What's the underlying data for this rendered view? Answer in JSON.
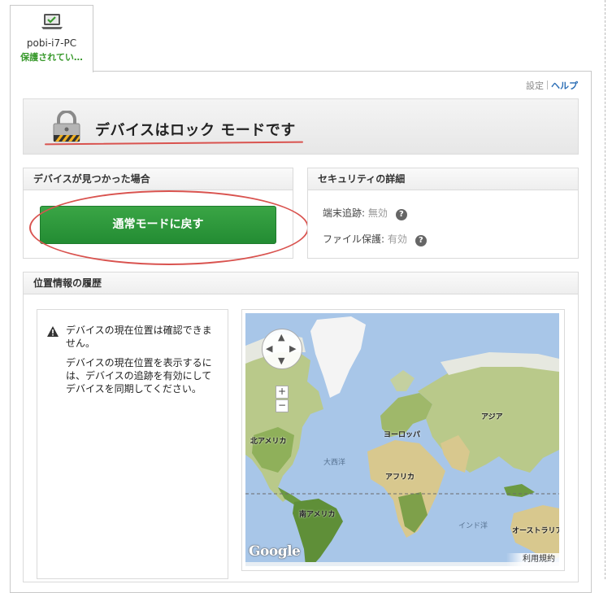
{
  "device_tab": {
    "name": "pobi-i7-PC",
    "status": "保護されてい…",
    "icon": "laptop-check-icon"
  },
  "links": {
    "settings": "設定",
    "help": "ヘルプ"
  },
  "banner": {
    "title": "デバイスはロック モードです",
    "icon": "padlock-icon"
  },
  "found_panel": {
    "title": "デバイスが見つかった場合",
    "button": "通常モードに戻す"
  },
  "security_panel": {
    "title": "セキュリティの詳細",
    "rows": [
      {
        "label": "端末追跡: ",
        "value": "無効"
      },
      {
        "label": "ファイル保護: ",
        "value": "有効"
      }
    ],
    "help_icon": "?"
  },
  "history_panel": {
    "title": "位置情報の履歴",
    "message_primary": "デバイスの現在位置は確認できません。",
    "message_secondary": "デバイスの現在位置を表示するには、デバイスの追跡を有効にしてデバイスを同期してください。"
  },
  "map": {
    "labels": {
      "north_america": "北アメリカ",
      "europe": "ヨーロッパ",
      "asia": "アジア",
      "atlantic": "大西洋",
      "africa": "アフリカ",
      "south_america": "南アメリカ",
      "indian_ocean": "インド洋",
      "australia": "オーストラリア"
    },
    "zoom_in": "+",
    "zoom_out": "−",
    "logo": "Google",
    "terms": "利用規約"
  },
  "colors": {
    "accent_green": "#2a9a3a",
    "status_green": "#3a9a2e",
    "link_blue": "#2a6db5",
    "annotation_red": "#d9534f"
  }
}
